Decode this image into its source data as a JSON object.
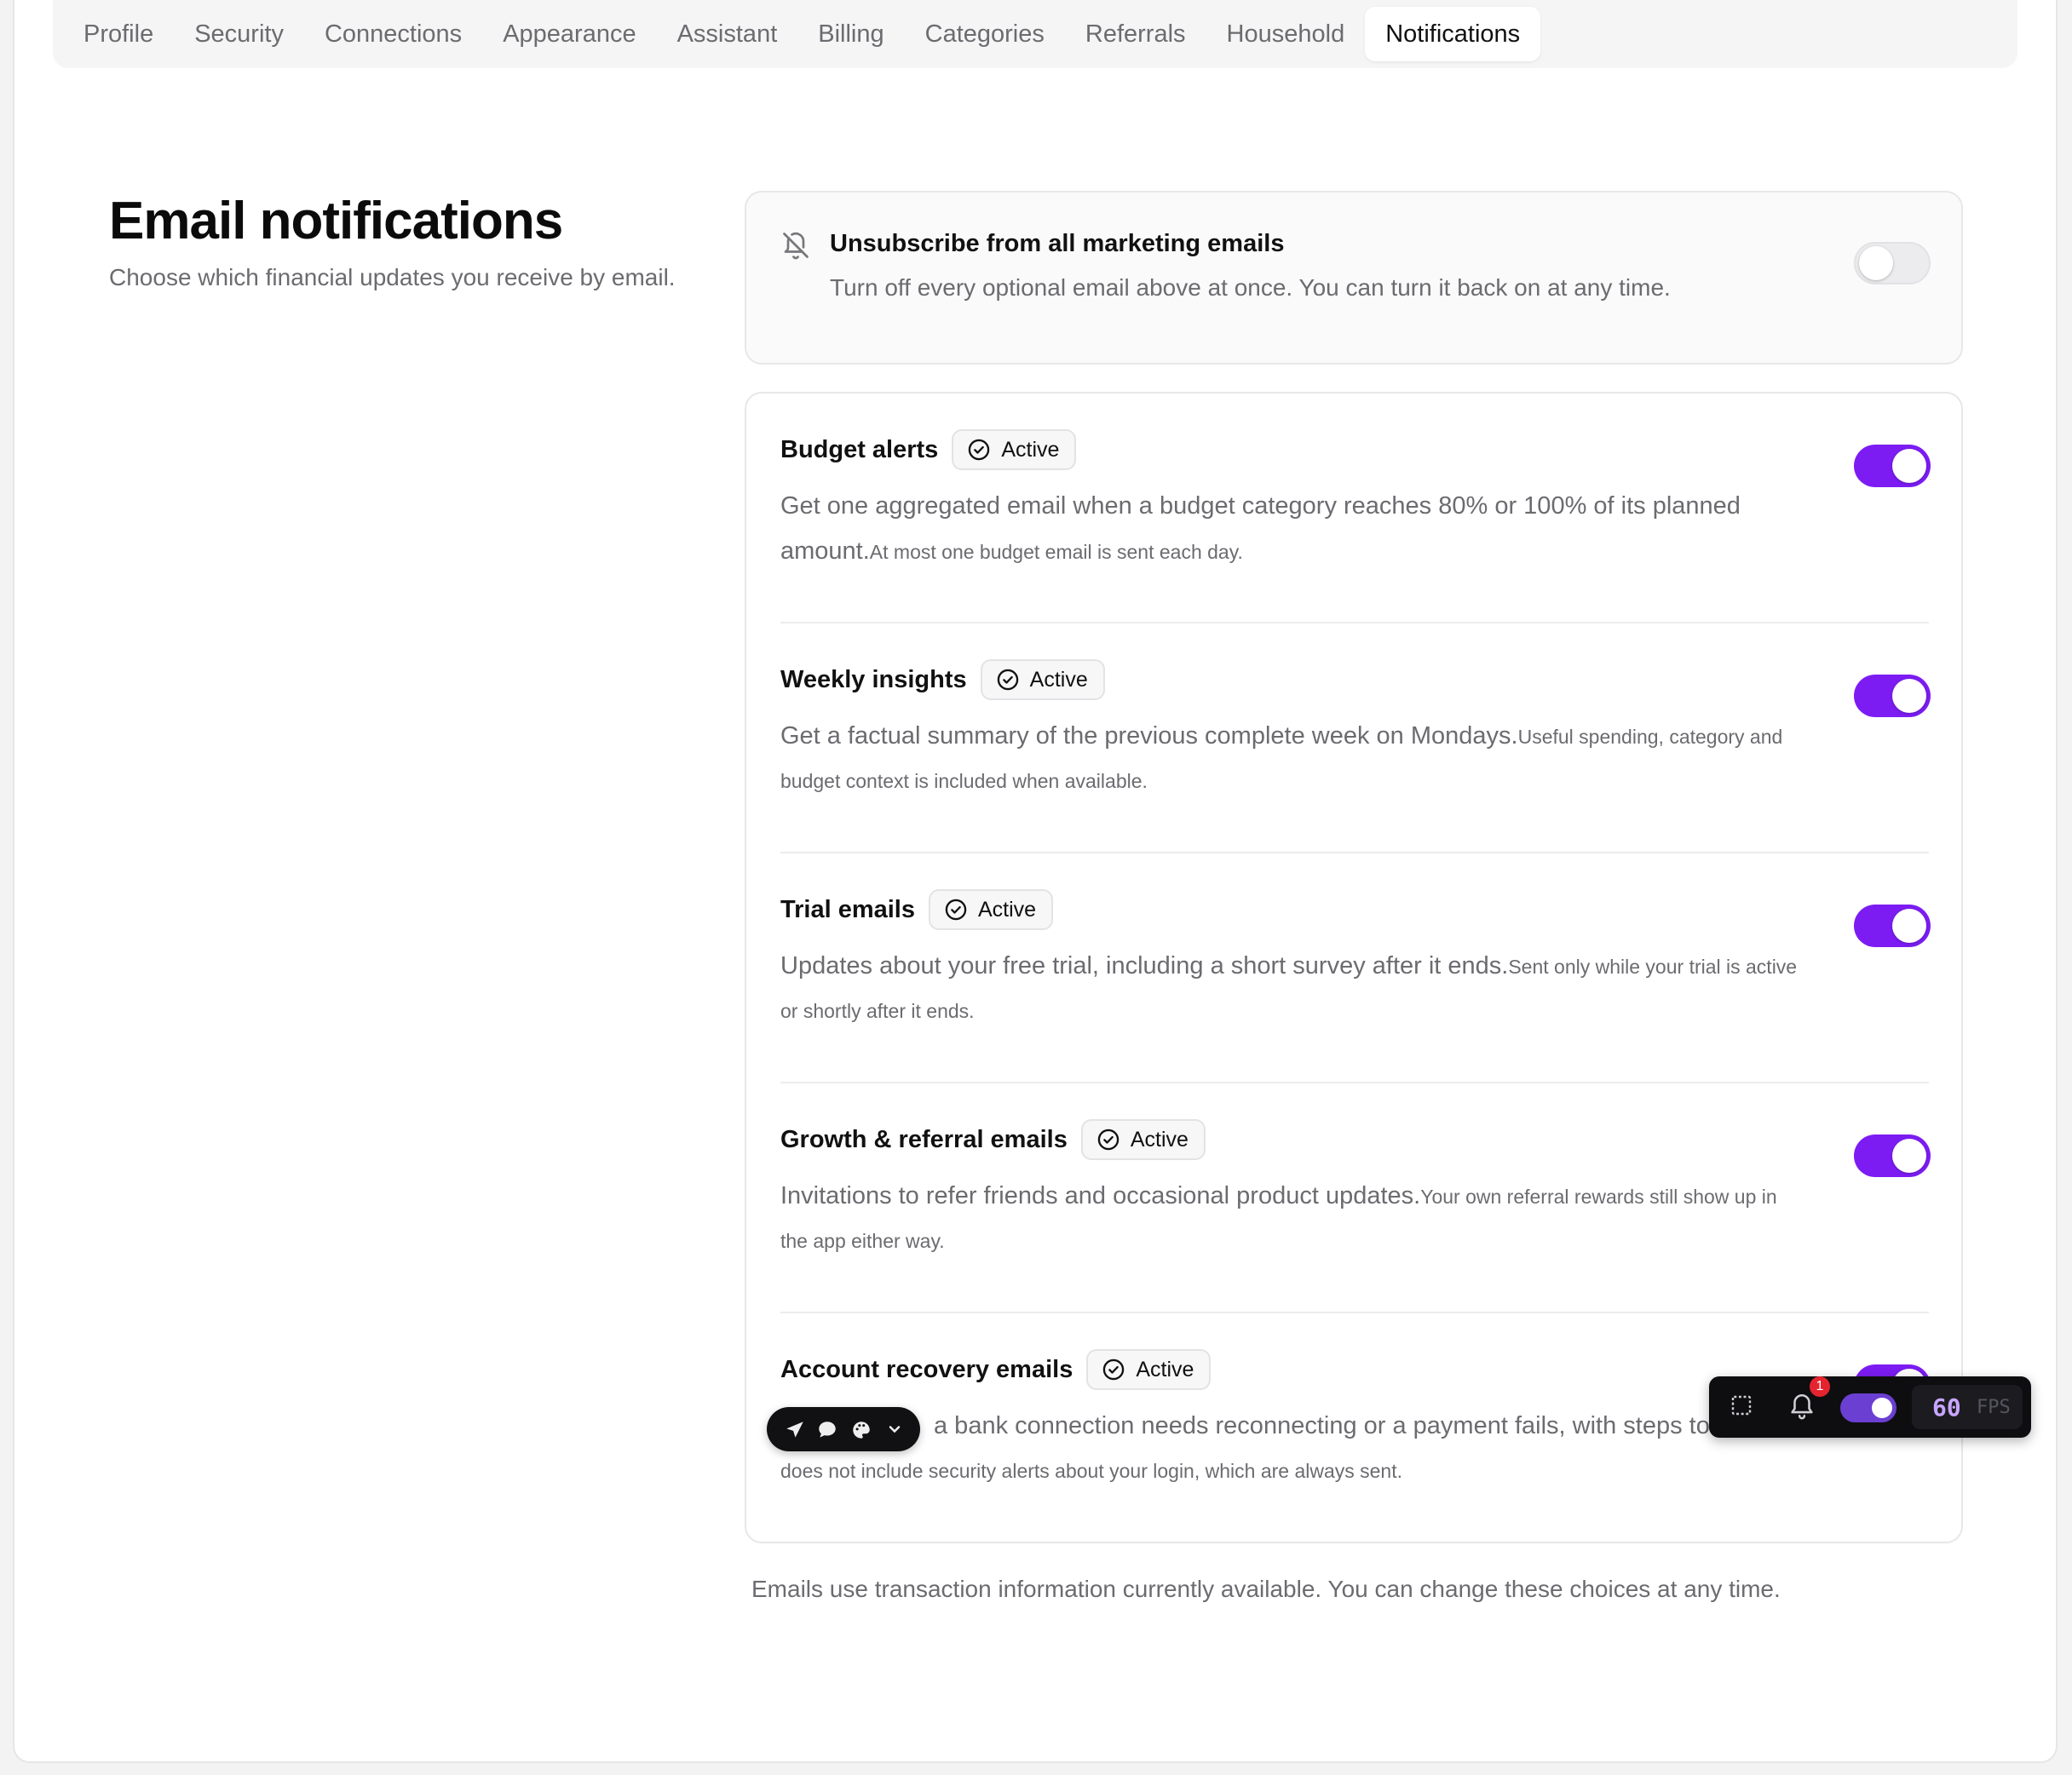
{
  "tabs": [
    {
      "label": "Profile"
    },
    {
      "label": "Security"
    },
    {
      "label": "Connections"
    },
    {
      "label": "Appearance"
    },
    {
      "label": "Assistant"
    },
    {
      "label": "Billing"
    },
    {
      "label": "Categories"
    },
    {
      "label": "Referrals"
    },
    {
      "label": "Household"
    },
    {
      "label": "Notifications",
      "active": true
    }
  ],
  "page": {
    "title": "Email notifications",
    "subtitle": "Choose which financial updates you receive by email."
  },
  "unsubscribe": {
    "title": "Unsubscribe from all marketing emails",
    "description": "Turn off every optional email above at once. You can turn it back on at any time.",
    "enabled": false,
    "icon": "bell-off-icon"
  },
  "items": [
    {
      "title": "Budget alerts",
      "badge": "Active",
      "description": "Get one aggregated email when a budget category reaches 80% or 100% of its planned amount.",
      "note": "At most one budget email is sent each day.",
      "enabled": true
    },
    {
      "title": "Weekly insights",
      "badge": "Active",
      "description": "Get a factual summary of the previous complete week on Mondays.",
      "note": "Useful spending, category and budget context is included when available.",
      "enabled": true
    },
    {
      "title": "Trial emails",
      "badge": "Active",
      "description": "Updates about your free trial, including a short survey after it ends.",
      "note": "Sent only while your trial is active or shortly after it ends.",
      "enabled": true
    },
    {
      "title": "Growth & referral emails",
      "badge": "Active",
      "description": "Invitations to refer friends and occasional product updates.",
      "note": "Your own referral rewards still show up in the app either way.",
      "enabled": true
    },
    {
      "title": "Account recovery emails",
      "badge": "Active",
      "description": "a bank connection needs reconnecting or a payment fails, with steps to fi",
      "note": "does not include security alerts about your login, which are always sent.",
      "enabled": true
    }
  ],
  "footnote": "Emails use transaction information currently available. You can change these choices at any time.",
  "devtools": {
    "notification_count": "1",
    "fps_value": "60",
    "fps_label": "FPS"
  },
  "colors": {
    "accent": "#7c1cf3",
    "muted_text": "#6b6b70",
    "badge_bg": "#f7f7f8",
    "alert_dot": "#e5242f"
  }
}
